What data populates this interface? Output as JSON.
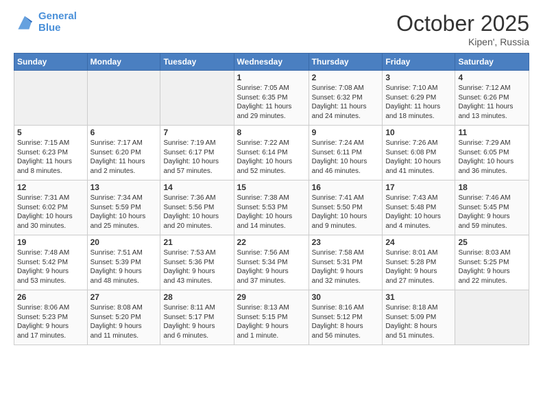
{
  "header": {
    "logo_line1": "General",
    "logo_line2": "Blue",
    "month": "October 2025",
    "location": "Kipen', Russia"
  },
  "weekdays": [
    "Sunday",
    "Monday",
    "Tuesday",
    "Wednesday",
    "Thursday",
    "Friday",
    "Saturday"
  ],
  "weeks": [
    [
      {
        "day": "",
        "info": ""
      },
      {
        "day": "",
        "info": ""
      },
      {
        "day": "",
        "info": ""
      },
      {
        "day": "1",
        "info": "Sunrise: 7:05 AM\nSunset: 6:35 PM\nDaylight: 11 hours\nand 29 minutes."
      },
      {
        "day": "2",
        "info": "Sunrise: 7:08 AM\nSunset: 6:32 PM\nDaylight: 11 hours\nand 24 minutes."
      },
      {
        "day": "3",
        "info": "Sunrise: 7:10 AM\nSunset: 6:29 PM\nDaylight: 11 hours\nand 18 minutes."
      },
      {
        "day": "4",
        "info": "Sunrise: 7:12 AM\nSunset: 6:26 PM\nDaylight: 11 hours\nand 13 minutes."
      }
    ],
    [
      {
        "day": "5",
        "info": "Sunrise: 7:15 AM\nSunset: 6:23 PM\nDaylight: 11 hours\nand 8 minutes."
      },
      {
        "day": "6",
        "info": "Sunrise: 7:17 AM\nSunset: 6:20 PM\nDaylight: 11 hours\nand 2 minutes."
      },
      {
        "day": "7",
        "info": "Sunrise: 7:19 AM\nSunset: 6:17 PM\nDaylight: 10 hours\nand 57 minutes."
      },
      {
        "day": "8",
        "info": "Sunrise: 7:22 AM\nSunset: 6:14 PM\nDaylight: 10 hours\nand 52 minutes."
      },
      {
        "day": "9",
        "info": "Sunrise: 7:24 AM\nSunset: 6:11 PM\nDaylight: 10 hours\nand 46 minutes."
      },
      {
        "day": "10",
        "info": "Sunrise: 7:26 AM\nSunset: 6:08 PM\nDaylight: 10 hours\nand 41 minutes."
      },
      {
        "day": "11",
        "info": "Sunrise: 7:29 AM\nSunset: 6:05 PM\nDaylight: 10 hours\nand 36 minutes."
      }
    ],
    [
      {
        "day": "12",
        "info": "Sunrise: 7:31 AM\nSunset: 6:02 PM\nDaylight: 10 hours\nand 30 minutes."
      },
      {
        "day": "13",
        "info": "Sunrise: 7:34 AM\nSunset: 5:59 PM\nDaylight: 10 hours\nand 25 minutes."
      },
      {
        "day": "14",
        "info": "Sunrise: 7:36 AM\nSunset: 5:56 PM\nDaylight: 10 hours\nand 20 minutes."
      },
      {
        "day": "15",
        "info": "Sunrise: 7:38 AM\nSunset: 5:53 PM\nDaylight: 10 hours\nand 14 minutes."
      },
      {
        "day": "16",
        "info": "Sunrise: 7:41 AM\nSunset: 5:50 PM\nDaylight: 10 hours\nand 9 minutes."
      },
      {
        "day": "17",
        "info": "Sunrise: 7:43 AM\nSunset: 5:48 PM\nDaylight: 10 hours\nand 4 minutes."
      },
      {
        "day": "18",
        "info": "Sunrise: 7:46 AM\nSunset: 5:45 PM\nDaylight: 9 hours\nand 59 minutes."
      }
    ],
    [
      {
        "day": "19",
        "info": "Sunrise: 7:48 AM\nSunset: 5:42 PM\nDaylight: 9 hours\nand 53 minutes."
      },
      {
        "day": "20",
        "info": "Sunrise: 7:51 AM\nSunset: 5:39 PM\nDaylight: 9 hours\nand 48 minutes."
      },
      {
        "day": "21",
        "info": "Sunrise: 7:53 AM\nSunset: 5:36 PM\nDaylight: 9 hours\nand 43 minutes."
      },
      {
        "day": "22",
        "info": "Sunrise: 7:56 AM\nSunset: 5:34 PM\nDaylight: 9 hours\nand 37 minutes."
      },
      {
        "day": "23",
        "info": "Sunrise: 7:58 AM\nSunset: 5:31 PM\nDaylight: 9 hours\nand 32 minutes."
      },
      {
        "day": "24",
        "info": "Sunrise: 8:01 AM\nSunset: 5:28 PM\nDaylight: 9 hours\nand 27 minutes."
      },
      {
        "day": "25",
        "info": "Sunrise: 8:03 AM\nSunset: 5:25 PM\nDaylight: 9 hours\nand 22 minutes."
      }
    ],
    [
      {
        "day": "26",
        "info": "Sunrise: 8:06 AM\nSunset: 5:23 PM\nDaylight: 9 hours\nand 17 minutes."
      },
      {
        "day": "27",
        "info": "Sunrise: 8:08 AM\nSunset: 5:20 PM\nDaylight: 9 hours\nand 11 minutes."
      },
      {
        "day": "28",
        "info": "Sunrise: 8:11 AM\nSunset: 5:17 PM\nDaylight: 9 hours\nand 6 minutes."
      },
      {
        "day": "29",
        "info": "Sunrise: 8:13 AM\nSunset: 5:15 PM\nDaylight: 9 hours\nand 1 minute."
      },
      {
        "day": "30",
        "info": "Sunrise: 8:16 AM\nSunset: 5:12 PM\nDaylight: 8 hours\nand 56 minutes."
      },
      {
        "day": "31",
        "info": "Sunrise: 8:18 AM\nSunset: 5:09 PM\nDaylight: 8 hours\nand 51 minutes."
      },
      {
        "day": "",
        "info": ""
      }
    ]
  ]
}
